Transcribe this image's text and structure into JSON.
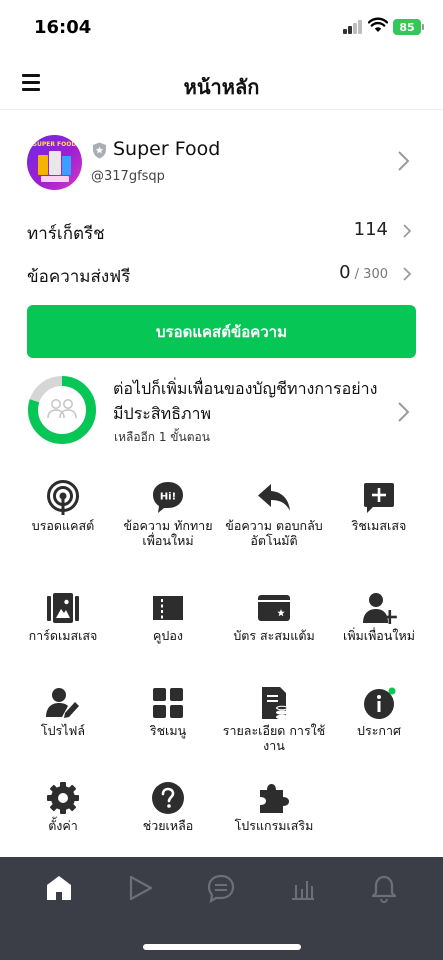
{
  "status_bar": {
    "time": "16:04",
    "battery": "85"
  },
  "header": {
    "title": "หน้าหลัก"
  },
  "account": {
    "avatar_text": "SUPER FOOD",
    "name": "Super Food",
    "id": "@317gfsqp"
  },
  "stats": {
    "target": {
      "label": "ทาร์เก็ตรีช",
      "value": "114"
    },
    "messages": {
      "label": "ข้อความส่งฟรี",
      "value": "0",
      "limit": " / 300"
    }
  },
  "broadcast_button": "บรอดแคสต์ข้อความ",
  "progress": {
    "title": "ต่อไปก็เพิ่มเพื่อนของบัญชีทางการอย่างมีประสิทธิภาพ",
    "subtitle": "เหลืออีก 1 ขั้นตอน",
    "fraction": 0.8,
    "color": "#06c755",
    "track_color": "#d6d6d6"
  },
  "menu": {
    "broadcast": "บรอดแคสต์",
    "greeting": "ข้อความ ทักทาย เพื่อนใหม่",
    "auto_reply": "ข้อความ ตอบกลับ อัตโนมัติ",
    "rich_message": "ริชเมสเสจ",
    "card_message": "การ์ดเมสเสจ",
    "coupon": "คูปอง",
    "reward_card": "บัตร สะสมแต้ม",
    "add_friends": "เพิ่มเพื่อนใหม่",
    "profile": "โปรไฟล์",
    "rich_menu": "ริชเมนู",
    "usage": "รายละเอียด การใช้งาน",
    "announcement": "ประกาศ",
    "settings": "ตั้งค่า",
    "help": "ช่วยเหลือ",
    "addons": "โปรแกรมเสริม",
    "hi_badge": "Hi!"
  },
  "colors": {
    "accent": "#06c755",
    "tabbar": "#3c3e47",
    "dark_icon": "#2d2d2d",
    "notify_dot": "#06c755"
  },
  "tabs": [
    "home-icon",
    "chat-play-icon",
    "chat-icon",
    "stats-icon",
    "bell-icon"
  ]
}
